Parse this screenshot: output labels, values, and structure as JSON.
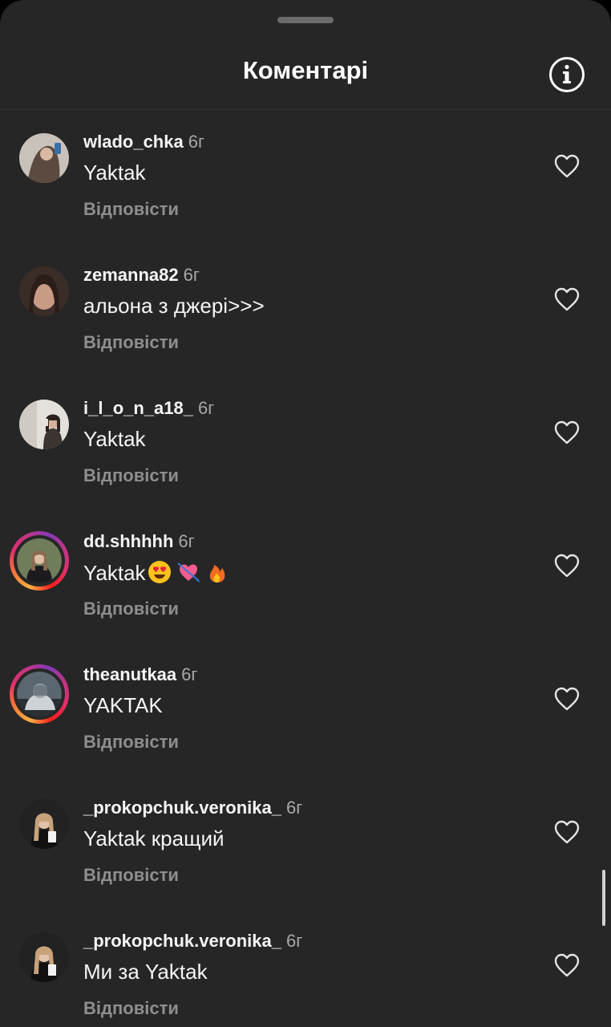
{
  "header": {
    "title": "Коментарі",
    "info_icon": "info-circle-icon"
  },
  "comments": [
    {
      "username": "wlado_chka",
      "time": "6г",
      "text": "Yaktak",
      "reply": "Відповісти",
      "story_ring": false,
      "avatar_colors": [
        "#c9c2bb",
        "#5b4a3f"
      ]
    },
    {
      "username": "zemanna82",
      "time": "6г",
      "text": "альона з джері>>>",
      "reply": "Відповісти",
      "story_ring": false,
      "avatar_colors": [
        "#3a2c26",
        "#c89b85"
      ]
    },
    {
      "username": "i_l_o_n_a18_",
      "time": "6г",
      "text": "Yaktak",
      "reply": "Відповісти",
      "story_ring": false,
      "avatar_colors": [
        "#e4e1dc",
        "#3b3431"
      ]
    },
    {
      "username": "dd.shhhhh",
      "time": "6г",
      "text": "Yaktak",
      "emojis": [
        "heart-eyes-emoji",
        "heart-arrow-emoji",
        "fire-emoji"
      ],
      "reply": "Відповісти",
      "story_ring": true,
      "avatar_colors": [
        "#6f7d5a",
        "#1b1b1f"
      ]
    },
    {
      "username": "theanutkaa",
      "time": "6г",
      "text": "YAKTAK",
      "reply": "Відповісти",
      "story_ring": true,
      "avatar_colors": [
        "#4a5560",
        "#2a2f33"
      ]
    },
    {
      "username": "_prokopchuk.veronika_",
      "time": "6г",
      "text": "Yaktak кращий",
      "reply": "Відповісти",
      "story_ring": false,
      "avatar_colors": [
        "#222222",
        "#c7a27b"
      ]
    },
    {
      "username": "_prokopchuk.veronika_",
      "time": "6г",
      "text": "Ми за Yaktak",
      "reply": "Відповісти",
      "story_ring": false,
      "avatar_colors": [
        "#222222",
        "#c7a27b"
      ]
    }
  ],
  "like_icon": "heart-outline-icon",
  "colors": {
    "background": "#262626",
    "text": "#f5f5f5",
    "muted": "#a8a8a8",
    "reply": "#8e8e8e"
  }
}
